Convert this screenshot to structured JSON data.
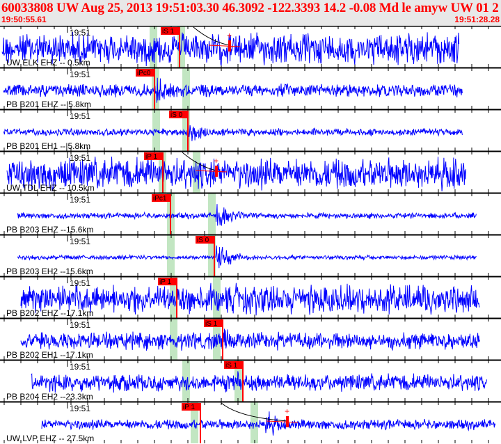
{
  "header": {
    "title": "60033808 UW Aug 25, 2013 19:51:03.30    46.3092 -122.3393 14.2 -0.08 Md le amyw UW 01    2",
    "start_time": "19:50:55.61",
    "end_time": "19:51:28.28"
  },
  "colors": {
    "trace": "#0000ff",
    "pick": "#ff0000",
    "window": "#c2e6c2",
    "header_bg": "#e8e8e8"
  },
  "rows": [
    {
      "station": "UW ELK EHZ -- 0.5km",
      "time_label": "19:51",
      "pick": "iS 1",
      "amp_marker": "+"
    },
    {
      "station": "PB B201 EHZ --|5.8km",
      "time_label": "19:51",
      "pick": "iPc0"
    },
    {
      "station": "PB B201 EH1 --|5.8km",
      "time_label": "19:51",
      "pick": "iS 0"
    },
    {
      "station": "UW TDL EHZ -- 10.5km",
      "time_label": "19:51",
      "pick": "iP 1",
      "amp_marker": "+"
    },
    {
      "station": "PB B203 EHZ --15.6km",
      "time_label": "19:51",
      "pick": "iPc1"
    },
    {
      "station": "PB B203 EH2 --15.6km",
      "time_label": "19:51",
      "pick": "iS 0"
    },
    {
      "station": "PB B202 EHZ --17.1km",
      "time_label": "19:51",
      "pick": "iP 1"
    },
    {
      "station": "PB B202 EH1 --17.1km",
      "time_label": "19:51",
      "pick": "iS 1"
    },
    {
      "station": "PB B204 EH2 --23.3km",
      "time_label": "19:51",
      "pick": "iS 1"
    },
    {
      "station": "UW LVP EHZ -- 27.5km",
      "time_label": "19:51",
      "pick": "iP 1",
      "amp_marker": "+"
    }
  ]
}
